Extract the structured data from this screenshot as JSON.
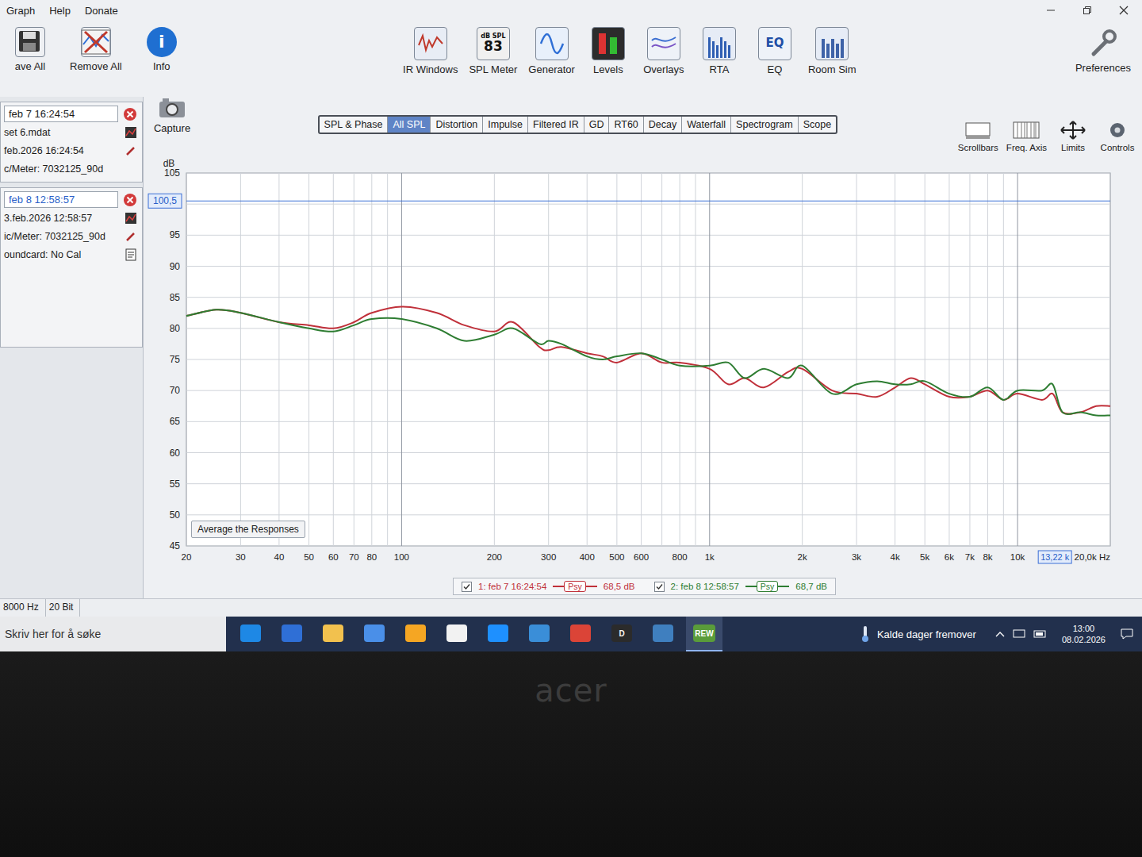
{
  "window": {
    "menu": [
      "Graph",
      "Help",
      "Donate"
    ]
  },
  "left_toolbar": [
    {
      "label": "ave All",
      "icon_text": []
    },
    {
      "label": "Remove All",
      "icon_text": []
    },
    {
      "label": "Info",
      "icon_text": [
        "i"
      ]
    }
  ],
  "toolbar": [
    {
      "label": "IR Windows",
      "icon_text": []
    },
    {
      "label": "SPL Meter",
      "icon_text": [
        "dB SPL",
        "83"
      ]
    },
    {
      "label": "Generator",
      "icon_text": []
    },
    {
      "label": "Levels",
      "icon_text": []
    },
    {
      "label": "Overlays",
      "icon_text": []
    },
    {
      "label": "RTA",
      "icon_text": []
    },
    {
      "label": "EQ",
      "icon_text": [
        "EQ"
      ]
    },
    {
      "label": "Room Sim",
      "icon_text": []
    }
  ],
  "preferences": {
    "label": "Preferences"
  },
  "capture": {
    "label": "Capture"
  },
  "measurements": [
    {
      "title": "feb 7 16:24:54",
      "selected": false,
      "lines": [
        "set 6.mdat",
        "feb.2026 16:24:54",
        "c/Meter: 7032125_90d"
      ]
    },
    {
      "title": "feb 8 12:58:57",
      "selected": true,
      "lines": [
        "3.feb.2026 12:58:57",
        "ic/Meter: 7032125_90d",
        "oundcard: No Cal"
      ]
    }
  ],
  "tabs": [
    {
      "label": "SPL & Phase",
      "selected": false
    },
    {
      "label": "All SPL",
      "selected": true
    },
    {
      "label": "Distortion",
      "selected": false
    },
    {
      "label": "Impulse",
      "selected": false
    },
    {
      "label": "Filtered IR",
      "selected": false
    },
    {
      "label": "GD",
      "selected": false
    },
    {
      "label": "RT60",
      "selected": false
    },
    {
      "label": "Decay",
      "selected": false
    },
    {
      "label": "Waterfall",
      "selected": false
    },
    {
      "label": "Spectrogram",
      "selected": false
    },
    {
      "label": "Scope",
      "selected": false
    }
  ],
  "graph_controls": [
    "Scrollbars",
    "Freq. Axis",
    "Limits",
    "Controls"
  ],
  "chart": {
    "y_unit": "dB",
    "y_ticks": [
      "105",
      "95",
      "90",
      "85",
      "80",
      "75",
      "70",
      "65",
      "60",
      "55",
      "50",
      "45"
    ],
    "x_ticks": [
      {
        "label": "20",
        "value": 20
      },
      {
        "label": "30",
        "value": 30
      },
      {
        "label": "40",
        "value": 40
      },
      {
        "label": "50",
        "value": 50
      },
      {
        "label": "60",
        "value": 60
      },
      {
        "label": "70",
        "value": 70
      },
      {
        "label": "80",
        "value": 80
      },
      {
        "label": "100",
        "value": 100
      },
      {
        "label": "200",
        "value": 200
      },
      {
        "label": "300",
        "value": 300
      },
      {
        "label": "400",
        "value": 400
      },
      {
        "label": "500",
        "value": 500
      },
      {
        "label": "600",
        "value": 600
      },
      {
        "label": "800",
        "value": 800
      },
      {
        "label": "1k",
        "value": 1000
      },
      {
        "label": "2k",
        "value": 2000
      },
      {
        "label": "3k",
        "value": 3000
      },
      {
        "label": "4k",
        "value": 4000
      },
      {
        "label": "5k",
        "value": 5000
      },
      {
        "label": "6k",
        "value": 6000
      },
      {
        "label": "7k",
        "value": 7000
      },
      {
        "label": "8k",
        "value": 8000
      },
      {
        "label": "10k",
        "value": 10000
      },
      {
        "label": "20,0k Hz",
        "value": 20000
      }
    ],
    "y_cursor": {
      "label": "100,5",
      "value": 100.5
    },
    "x_cursor": {
      "label": "13,22 k",
      "value": 13220
    },
    "average_button": "Average the Responses",
    "frequencies": [
      20,
      25,
      30,
      40,
      50,
      60,
      70,
      80,
      100,
      130,
      160,
      200,
      230,
      280,
      300,
      330,
      400,
      450,
      500,
      600,
      700,
      800,
      1000,
      1150,
      1300,
      1500,
      1800,
      2000,
      2500,
      3000,
      3500,
      4000,
      4500,
      5000,
      6000,
      7000,
      8000,
      9000,
      10000,
      12000,
      13000,
      14000,
      16000,
      18000,
      20000
    ],
    "series": [
      {
        "label": "1: feb 7 16:24:54",
        "checked": true,
        "smoothing": "Psy",
        "reading": "68,5 dB",
        "color": "#c0303a",
        "values": [
          82,
          83,
          82.5,
          81,
          80.5,
          80,
          81,
          82.5,
          83.5,
          82.5,
          80.5,
          79.5,
          81,
          77,
          76.5,
          77,
          76,
          75.5,
          74.5,
          76,
          74.5,
          74.5,
          73.5,
          71,
          72,
          70.5,
          73,
          73.5,
          70,
          69.5,
          69,
          70.5,
          72,
          71,
          69,
          69,
          70,
          68.5,
          69.5,
          68.5,
          69.5,
          66.5,
          66.5,
          67.5,
          67.5
        ]
      },
      {
        "label": "2: feb 8 12:58:57",
        "checked": true,
        "smoothing": "Psy",
        "reading": "68,7 dB",
        "color": "#2e7d32",
        "values": [
          82,
          83,
          82.5,
          81,
          80,
          79.5,
          80.5,
          81.5,
          81.5,
          80,
          78,
          79,
          80,
          77.5,
          78,
          77.5,
          75.5,
          75,
          75.5,
          76,
          75,
          74,
          74,
          74.5,
          72,
          73.5,
          72,
          74,
          69.5,
          71,
          71.5,
          71,
          71,
          71.5,
          69.5,
          69,
          70.5,
          68.5,
          70,
          70,
          71,
          66.5,
          66.5,
          66,
          66
        ]
      }
    ]
  },
  "status_bar": [
    "8000 Hz",
    "20 Bit"
  ],
  "taskbar": {
    "search_placeholder": "Skriv her for å søke",
    "apps": [
      {
        "text": "",
        "selected": false
      },
      {
        "text": "",
        "selected": false
      },
      {
        "text": "",
        "selected": false
      },
      {
        "text": "",
        "selected": false
      },
      {
        "text": "",
        "selected": false
      },
      {
        "text": "",
        "selected": false
      },
      {
        "text": "",
        "selected": false
      },
      {
        "text": "",
        "selected": false
      },
      {
        "text": "",
        "selected": false
      },
      {
        "text": "D",
        "selected": false
      },
      {
        "text": "",
        "selected": false
      },
      {
        "text": "REW",
        "selected": true
      }
    ],
    "weather": "Kalde dager fremover",
    "time": "13:00",
    "date": "08.02.2026"
  },
  "device": {
    "logo": "acer"
  }
}
